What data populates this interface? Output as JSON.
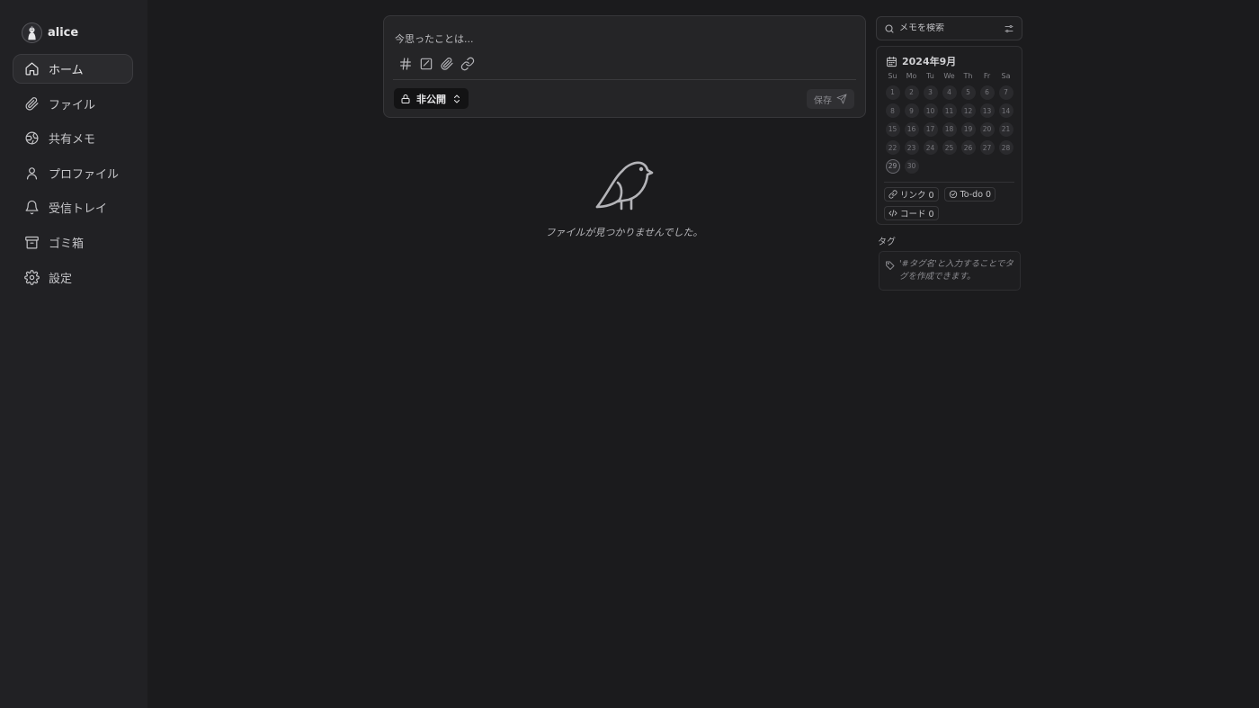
{
  "user": {
    "name": "alice"
  },
  "nav": [
    {
      "label": "ホーム",
      "icon": "home-icon",
      "active": true
    },
    {
      "label": "ファイル",
      "icon": "paperclip-icon"
    },
    {
      "label": "共有メモ",
      "icon": "globe-icon"
    },
    {
      "label": "プロファイル",
      "icon": "user-icon"
    },
    {
      "label": "受信トレイ",
      "icon": "bell-icon"
    },
    {
      "label": "ゴミ箱",
      "icon": "archive-icon"
    },
    {
      "label": "設定",
      "icon": "gear-icon"
    }
  ],
  "editor": {
    "placeholder": "今思ったことは...",
    "toolbar": [
      "hash-icon",
      "checkbox-icon",
      "paperclip-icon",
      "link-icon"
    ],
    "visibility": "非公開",
    "save_label": "保存"
  },
  "empty_state": {
    "message": "ファイルが見つかりませんでした。"
  },
  "search": {
    "placeholder": "メモを検索"
  },
  "calendar": {
    "title": "2024年9月",
    "weekdays": [
      "Su",
      "Mo",
      "Tu",
      "We",
      "Th",
      "Fr",
      "Sa"
    ],
    "days": [
      "1",
      "2",
      "3",
      "4",
      "5",
      "6",
      "7",
      "8",
      "9",
      "10",
      "11",
      "12",
      "13",
      "14",
      "15",
      "16",
      "17",
      "18",
      "19",
      "20",
      "21",
      "22",
      "23",
      "24",
      "25",
      "26",
      "27",
      "28",
      "29",
      "30"
    ],
    "today": "29"
  },
  "stats": {
    "link": "リンク 0",
    "todo": "To-do 0",
    "code": "コード 0"
  },
  "tags": {
    "title": "タグ",
    "hint": "'#タグ名'と入力することでタグを作成できます。"
  },
  "colors": {
    "background": "#1b1b1d",
    "sidebar": "#212124",
    "panel": "#252527"
  }
}
